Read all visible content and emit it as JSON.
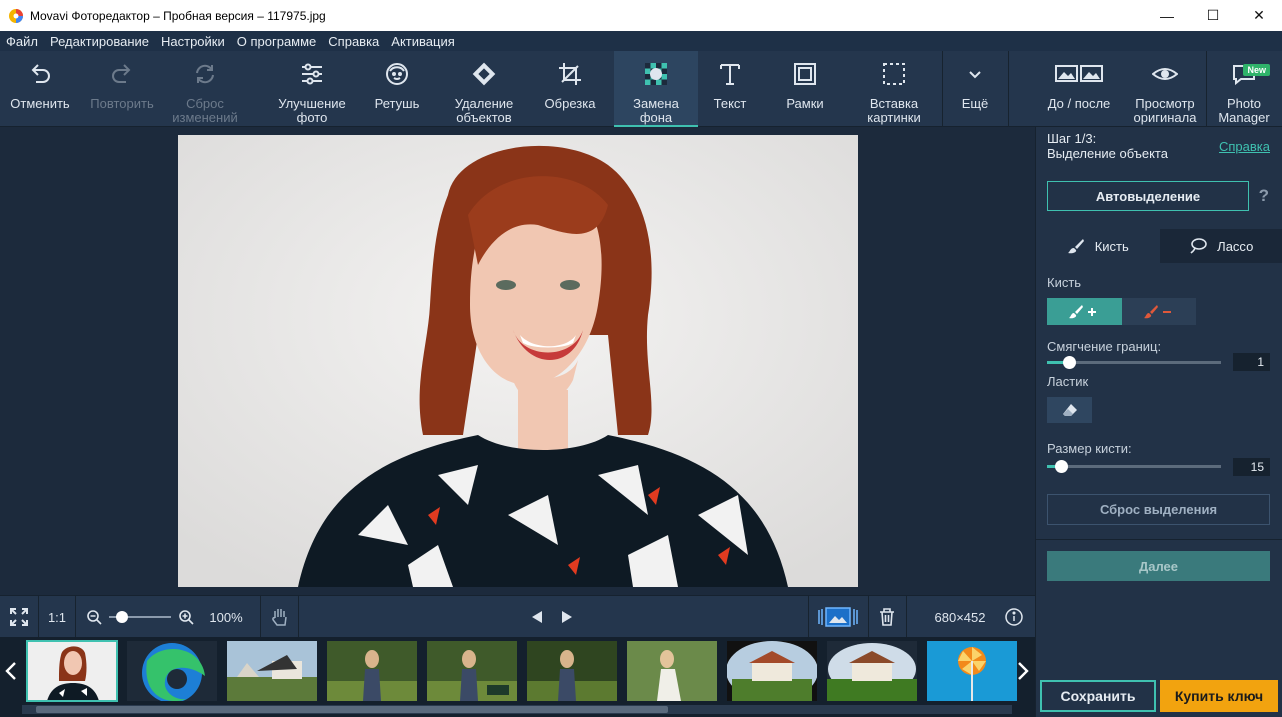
{
  "window": {
    "title": "Movavi Фоторедактор – Пробная версия – 117975.jpg",
    "minimize": "—",
    "maximize": "☐",
    "close": "✕"
  },
  "menu": [
    "Файл",
    "Редактирование",
    "Настройки",
    "О программе",
    "Справка",
    "Активация"
  ],
  "toolbar": {
    "undo": "Отменить",
    "redo": "Повторить",
    "reset": "Сброс\nизменений",
    "enhance": "Улучшение\nфото",
    "retouch": "Ретушь",
    "remove_objects": "Удаление\nобъектов",
    "crop": "Обрезка",
    "replace_bg": "Замена\nфона",
    "text": "Текст",
    "frames": "Рамки",
    "insert_image": "Вставка\nкартинки",
    "more": "Ещё",
    "before_after": "До / после",
    "view_original": "Просмотр\nоригинала",
    "photo_manager": "Photo\nManager",
    "new_badge": "New"
  },
  "bottom_bar": {
    "fit_label": "1:1",
    "zoom": "100%",
    "dimensions": "680×452",
    "zoom_level": 0.14
  },
  "panel": {
    "step_line1": "Шаг 1/3:",
    "step_line2": "Выделение объекта",
    "help": "Справка",
    "auto_select": "Автовыделение",
    "question": "?",
    "tab_brush": "Кисть",
    "tab_lasso": "Лассо",
    "brush_label": "Кисть",
    "feather_label": "Смягчение границ:",
    "feather_value": "1",
    "eraser_label": "Ластик",
    "brush_size_label": "Размер кисти:",
    "brush_size_value": "15",
    "reset_selection": "Сброс выделения",
    "next": "Далее"
  },
  "actions": {
    "save": "Сохранить",
    "buy": "Купить ключ"
  },
  "colors": {
    "accent": "#3fc1b0",
    "buy": "#f2a30f",
    "toolbar": "#24364d",
    "background": "#1c2a3c"
  }
}
